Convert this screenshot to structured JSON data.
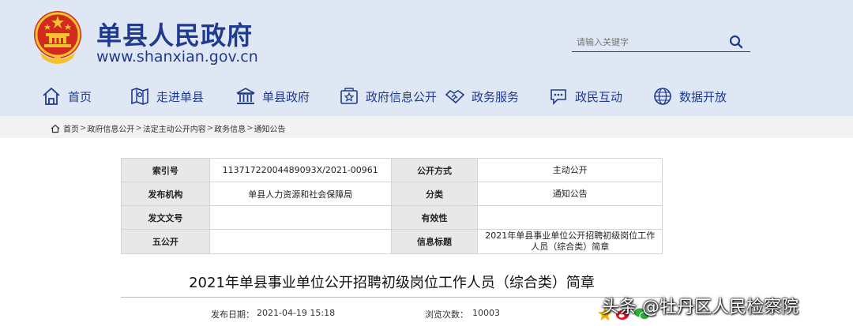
{
  "site": {
    "name": "单县人民政府",
    "url": "www.shanxian.gov.cn",
    "emblem_icon": "national-emblem",
    "brand_color": "#1f3b8f",
    "header_bg": "#dfe7f4"
  },
  "search": {
    "placeholder": "请输入关键字",
    "icon": "search-icon"
  },
  "nav": {
    "items": [
      {
        "label": "首页",
        "icon": "home-icon"
      },
      {
        "label": "走进单县",
        "icon": "map-icon"
      },
      {
        "label": "单县政府",
        "icon": "government-building-icon"
      },
      {
        "label": "政府信息公开",
        "icon": "info-disclosure-icon"
      },
      {
        "label": "政务服务",
        "icon": "handshake-icon"
      },
      {
        "label": "政民互动",
        "icon": "chat-icon"
      },
      {
        "label": "数据开放",
        "icon": "data-globe-icon"
      }
    ]
  },
  "breadcrumb": {
    "items": [
      "首页",
      "政府信息公开",
      "法定主动公开内容",
      "政务信息",
      "通知公告"
    ],
    "separator": ">"
  },
  "info": {
    "rows": [
      {
        "label1": "索引号",
        "value1": "11371722004489093X/2021-00961",
        "label2": "公开方式",
        "value2": "主动公开"
      },
      {
        "label1": "发布机构",
        "value1": "单县人力资源和社会保障局",
        "label2": "分类",
        "value2": "通知公告"
      },
      {
        "label1": "发文文号",
        "value1": "",
        "label2": "有效性",
        "value2": ""
      },
      {
        "label1": "五公开",
        "value1": "",
        "label2": "信息标题",
        "value2": "2021年单县事业单位公开招聘初级岗位工作人员（综合类）简章"
      }
    ]
  },
  "article": {
    "title": "2021年单县事业单位公开招聘初级岗位工作人员（综合类）简章",
    "date_label": "发布日期：",
    "date": "2021-04-19 15:18",
    "views_label": "浏览次数：",
    "views": "10003"
  },
  "watermark": {
    "text": "头条 @牡丹区人民检察院"
  }
}
